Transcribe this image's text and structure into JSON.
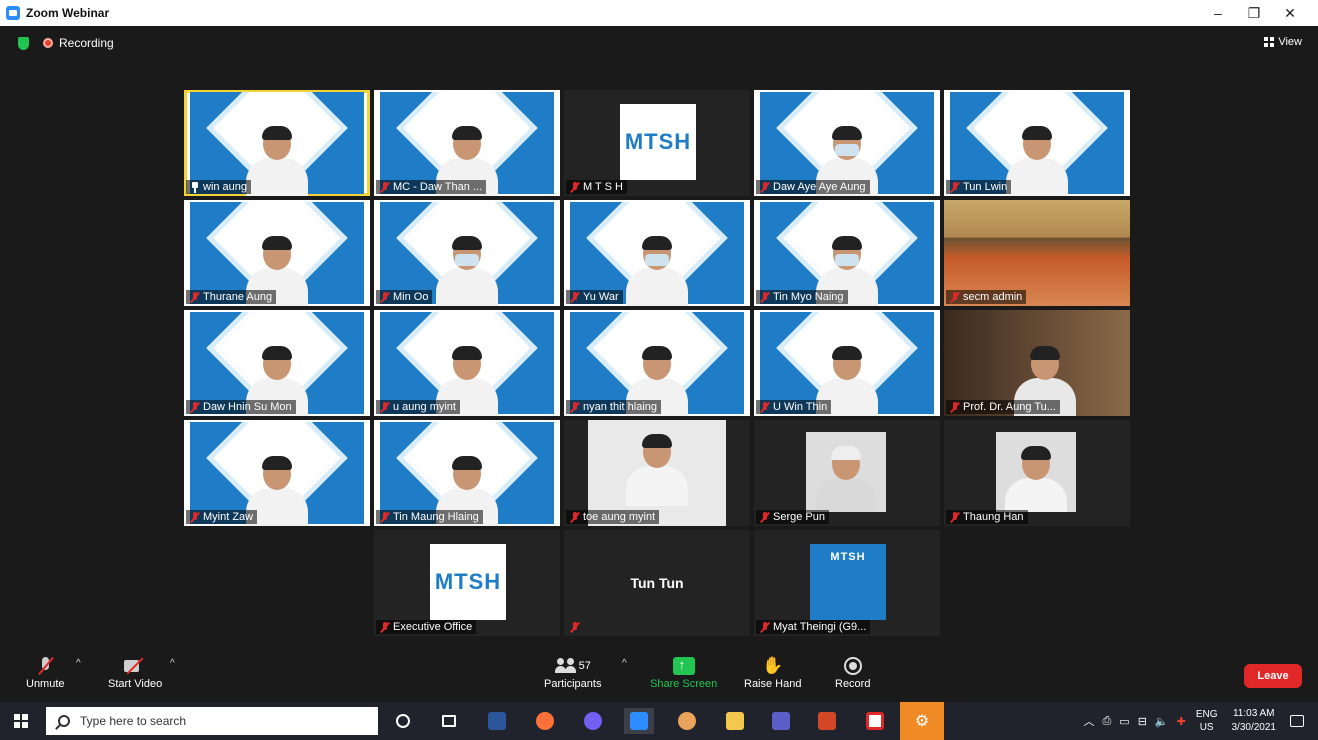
{
  "window": {
    "title": "Zoom Webinar",
    "controls": [
      "–",
      "❐",
      "✕"
    ]
  },
  "topbar": {
    "recording_label": "Recording",
    "view_label": "View"
  },
  "tiles": [
    {
      "name": "win aung",
      "kind": "mtsh",
      "active": true,
      "pinned": true
    },
    {
      "name": "MC - Daw Than ...",
      "kind": "mtsh"
    },
    {
      "name": "M T S H",
      "kind": "logo"
    },
    {
      "name": "Daw Aye Aye Aung",
      "kind": "mtsh"
    },
    {
      "name": "Tun Lwin",
      "kind": "mtsh"
    },
    {
      "name": "Thurane Aung",
      "kind": "mtsh"
    },
    {
      "name": "Min Oo",
      "kind": "mtsh"
    },
    {
      "name": "Yu War",
      "kind": "mtsh"
    },
    {
      "name": "Tin Myo Naing",
      "kind": "mtsh"
    },
    {
      "name": "secm admin",
      "kind": "room"
    },
    {
      "name": "Daw Hnin Su Mon",
      "kind": "mtsh"
    },
    {
      "name": "u aung myint",
      "kind": "mtsh"
    },
    {
      "name": "nyan thit hlaing",
      "kind": "mtsh"
    },
    {
      "name": "U Win Thin",
      "kind": "mtsh"
    },
    {
      "name": "Prof. Dr. Aung Tu...",
      "kind": "office"
    },
    {
      "name": "Myint Zaw",
      "kind": "mtsh"
    },
    {
      "name": "Tin Maung Hlaing",
      "kind": "mtsh"
    },
    {
      "name": "toe aung myint",
      "kind": "photo"
    },
    {
      "name": "Serge Pun",
      "kind": "photo"
    },
    {
      "name": "Thaung Han",
      "kind": "photo"
    },
    {
      "name": "Executive Office",
      "kind": "logo"
    },
    {
      "name": "",
      "kind": "nameonly",
      "center_text": "Tun Tun"
    },
    {
      "name": "Myat Theingi (G9...",
      "kind": "logo-small"
    }
  ],
  "mtsh_logo": {
    "text": "MTSH"
  },
  "controls": {
    "unmute_label": "Unmute",
    "start_video_label": "Start Video",
    "participants_label": "Participants",
    "participants_count": "57",
    "share_screen_label": "Share Screen",
    "raise_hand_label": "Raise Hand",
    "record_label": "Record",
    "leave_label": "Leave",
    "caret": "^"
  },
  "taskbar": {
    "search_placeholder": "Type here to search",
    "lang_top": "ENG",
    "lang_bottom": "US",
    "time": "11:03 AM",
    "date": "3/30/2021"
  },
  "colors": {
    "accent": "#2d8cff",
    "share_green": "#23c552",
    "leave_red": "#e02828",
    "active_border": "#f4d23a",
    "mtsh_blue": "#1f7dc7"
  }
}
